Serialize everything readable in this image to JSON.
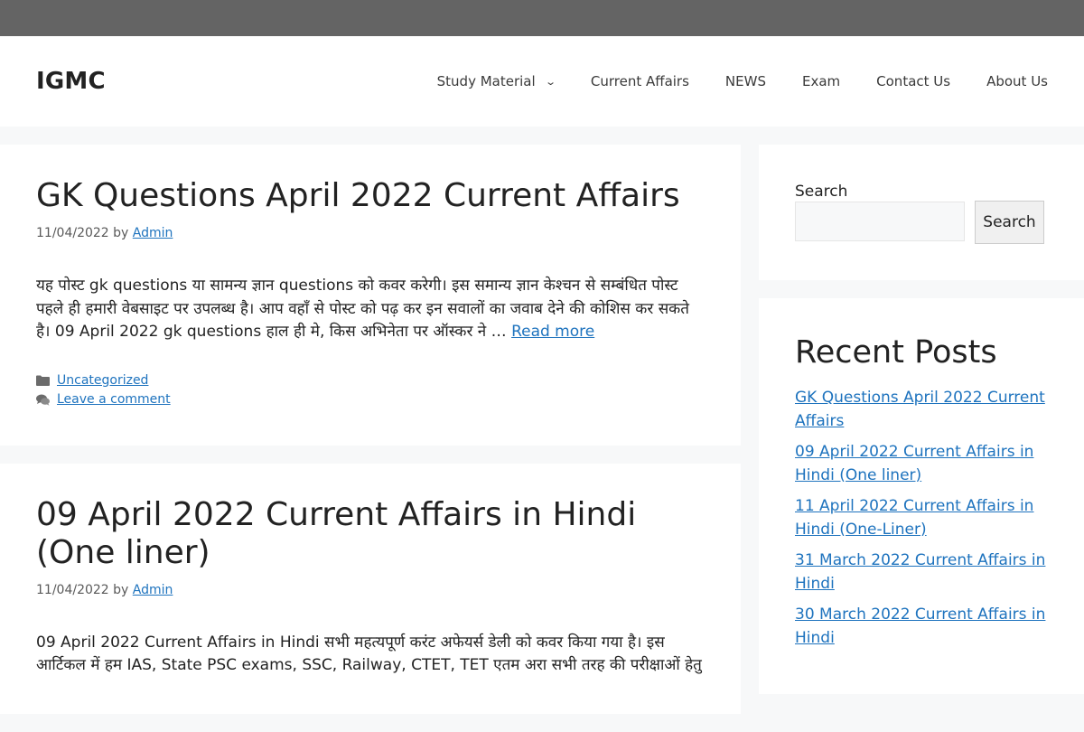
{
  "site": {
    "logo": "IGMC"
  },
  "nav": {
    "items": [
      {
        "label": "Study Material",
        "has_dropdown": true
      },
      {
        "label": "Current Affairs"
      },
      {
        "label": "NEWS"
      },
      {
        "label": "Exam"
      },
      {
        "label": "Contact Us"
      },
      {
        "label": "About Us"
      }
    ]
  },
  "posts": [
    {
      "title": "GK Questions April 2022 Current Affairs",
      "date": "11/04/2022",
      "by": "by",
      "author": "Admin",
      "excerpt": "यह पोस्ट gk questions या सामन्य ज्ञान questions को कवर करेगी। इस समान्य ज्ञान केश्चन से सम्बंधित पोस्ट पहले ही हमारी वेबसाइट पर उपलब्ध है। आप वहाँ से पोस्ट को पढ़ कर इन सवालों का जवाब देने की कोशिस कर सकते है। 09 April 2022 gk questions हाल ही मे, किस अभिनेता पर ऑस्कर ने …",
      "read_more": "Read more",
      "category": "Uncategorized",
      "comment": "Leave a comment"
    },
    {
      "title": "09 April 2022 Current Affairs in Hindi (One liner)",
      "date": "11/04/2022",
      "by": "by",
      "author": "Admin",
      "excerpt": "09 April 2022 Current Affairs in Hindi सभी महत्यपूर्ण करंट अफेयर्स डेली को कवर किया गया है। इस आर्टिकल में हम IAS, State PSC exams, SSC, Railway, CTET, TET एतम अरा सभी तरह की परीक्षाओं हेतु"
    }
  ],
  "sidebar": {
    "search_label": "Search",
    "search_button": "Search",
    "recent_title": "Recent Posts",
    "recent_posts": [
      "GK Questions April 2022 Current Affairs",
      "09 April 2022 Current Affairs in Hindi (One liner)",
      "11 April 2022 Current Affairs in Hindi (One-Liner)",
      "31 March 2022 Current Affairs in Hindi",
      "30 March 2022 Current Affairs in Hindi"
    ]
  },
  "colors": {
    "link": "#1e73be",
    "topbar": "#646464",
    "page_bg": "#f7f8f9"
  }
}
